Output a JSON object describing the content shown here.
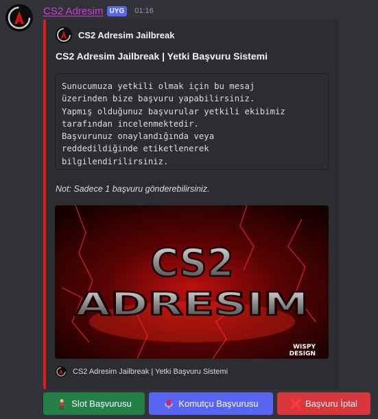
{
  "message": {
    "username": "CS2 Adresim",
    "app_badge": "UYG",
    "timestamp": "01:16"
  },
  "embed": {
    "accent_color": "#e01b1b",
    "author": "CS2 Adresim Jailbreak",
    "title": "CS2 Adresim Jailbreak | Yetki Başvuru Sistemi",
    "code_lines": [
      "Sunucumuza yetkili olmak için bu mesaj",
      "üzerinden bize başvuru yapabilirsiniz.",
      "Yapmış olduğunuz başvurular yetkili ekibimiz",
      "tarafından incelenmektedir.",
      "Başvurunuz onaylandığında veya",
      "reddedildiğinde etiketlenerek",
      "bilgilendirilirsiniz."
    ],
    "note": "Not: Sadece 1 başvuru gönderebilirsiniz.",
    "image": {
      "line1": "CS2",
      "line2": "ADRESIM",
      "watermark_line1": "WISPY",
      "watermark_line2": "DESIGN"
    },
    "footer": "CS2 Adresim Jailbreak | Yetki Başvuru Sistemi"
  },
  "buttons": [
    {
      "label": "Slot Başvurusu",
      "color": "#248046",
      "icon": "man-icon"
    },
    {
      "label": "Komutçu Başvurusu",
      "color": "#5865f2",
      "icon": "microphone-icon"
    },
    {
      "label": "Başvuru İptal",
      "color": "#da373c",
      "icon": "cross-mark-icon"
    }
  ]
}
